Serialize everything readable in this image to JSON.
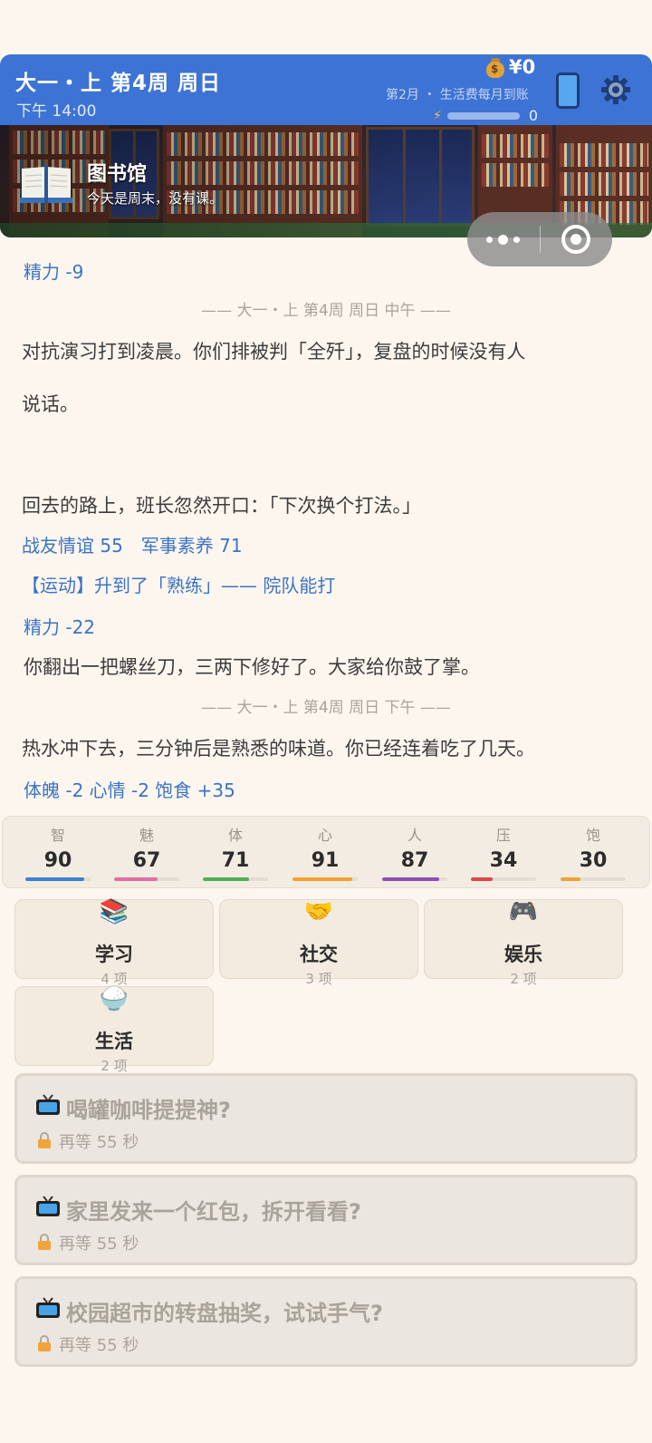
{
  "header": {
    "title": "大一・上 第4周 周日",
    "time": "下午 14:00",
    "money": "¥0",
    "month_note": "第2月 ・ 生活费每月到账",
    "energy_value": "0",
    "energy_fraction": 0,
    "colors": {
      "bar": "#3d73d4"
    }
  },
  "banner": {
    "location": "图书馆",
    "subtitle": "今天是周末，没有课。",
    "icon": "open-book-icon"
  },
  "log": {
    "cut_line": "精力 -9",
    "divider1": "—— 大一・上 第4周 周日 中午 ——",
    "para1_line1": "对抗演习打到凌晨。你们排被判「全歼」，复盘的时候没有人",
    "para1_line2": "说话。",
    "para2": "回去的路上，班长忽然开口：「下次换个打法。」",
    "stats1": "战友情谊 55　军事素养 71",
    "skill_up": "【运动】升到了「熟练」—— 院队能打",
    "energy_change": "精力 -22",
    "para3": "你翻出一把螺丝刀，三两下修好了。大家给你鼓了掌。",
    "divider2": "—— 大一・上 第4周 周日 下午 ——",
    "para4": "热水冲下去，三分钟后是熟悉的味道。你已经连着吃了几天。",
    "stats2": "体魄 -2  心情 -2  饱食 +35"
  },
  "stats": [
    {
      "label": "智",
      "value": "90",
      "fill": 0.9,
      "color": "#3f7fd0"
    },
    {
      "label": "魅",
      "value": "67",
      "fill": 0.67,
      "color": "#e06fa0"
    },
    {
      "label": "体",
      "value": "71",
      "fill": 0.71,
      "color": "#4fae5a"
    },
    {
      "label": "心",
      "value": "91",
      "fill": 0.91,
      "color": "#f0a234"
    },
    {
      "label": "人",
      "value": "87",
      "fill": 0.87,
      "color": "#8e4fb0"
    },
    {
      "label": "压",
      "value": "34",
      "fill": 0.34,
      "color": "#d9484a"
    },
    {
      "label": "饱",
      "value": "30",
      "fill": 0.3,
      "color": "#e8a33a"
    }
  ],
  "categories": [
    {
      "name": "学习",
      "count": "4 项",
      "icon": "books-icon",
      "glyph": "📚"
    },
    {
      "name": "社交",
      "count": "3 项",
      "icon": "handshake-icon",
      "glyph": "🤝"
    },
    {
      "name": "娱乐",
      "count": "2 项",
      "icon": "gamepad-icon",
      "glyph": "🎮"
    },
    {
      "name": "生活",
      "count": "2 项",
      "icon": "rice-bowl-icon",
      "glyph": "🍚"
    }
  ],
  "events": [
    {
      "title": "喝罐咖啡提提神?",
      "wait": "再等 55 秒"
    },
    {
      "title": "家里发来一个红包，拆开看看?",
      "wait": "再等 55 秒"
    },
    {
      "title": "校园超市的转盘抽奖，试试手气?",
      "wait": "再等 55 秒"
    }
  ]
}
